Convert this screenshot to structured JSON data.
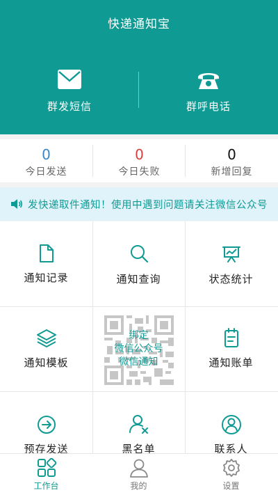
{
  "header": {
    "title": "快递通知宝",
    "actions": [
      {
        "label": "群发短信",
        "icon": "envelope-icon"
      },
      {
        "label": "群呼电话",
        "icon": "telephone-icon"
      }
    ]
  },
  "stats": [
    {
      "value": "0",
      "label": "今日发送",
      "color": "#3a87c8"
    },
    {
      "value": "0",
      "label": "今日失败",
      "color": "#d9403a"
    },
    {
      "value": "0",
      "label": "新增回复",
      "color": "#111111"
    }
  ],
  "notice": {
    "icon": "speaker-icon",
    "text": "发快递取件通知！使用中遇到问题请关注微信公众号"
  },
  "grid": {
    "items": [
      {
        "label": "通知记录",
        "icon": "document-icon"
      },
      {
        "label": "通知查询",
        "icon": "search-icon"
      },
      {
        "label": "状态统计",
        "icon": "chart-board-icon"
      },
      {
        "label": "通知模板",
        "icon": "layers-icon"
      },
      {
        "label": "通知账单",
        "icon": "clipboard-icon"
      },
      {
        "label": "预存发送",
        "icon": "arrow-circle-icon"
      },
      {
        "label": "黑名单",
        "icon": "user-block-icon"
      },
      {
        "label": "联系人",
        "icon": "contact-icon"
      }
    ],
    "qr": {
      "line1": "绑定",
      "line2": "微信公众号",
      "line3": "微信通知"
    }
  },
  "tabbar": {
    "tabs": [
      {
        "label": "工作台",
        "icon": "grid-icon",
        "active": true
      },
      {
        "label": "我的",
        "icon": "person-icon",
        "active": false
      },
      {
        "label": "设置",
        "icon": "gear-icon",
        "active": false
      }
    ]
  },
  "colors": {
    "primary": "#0f9a94",
    "notice_bg": "#e1f3fa",
    "stat_blue": "#3a87c8",
    "stat_red": "#d9403a"
  }
}
